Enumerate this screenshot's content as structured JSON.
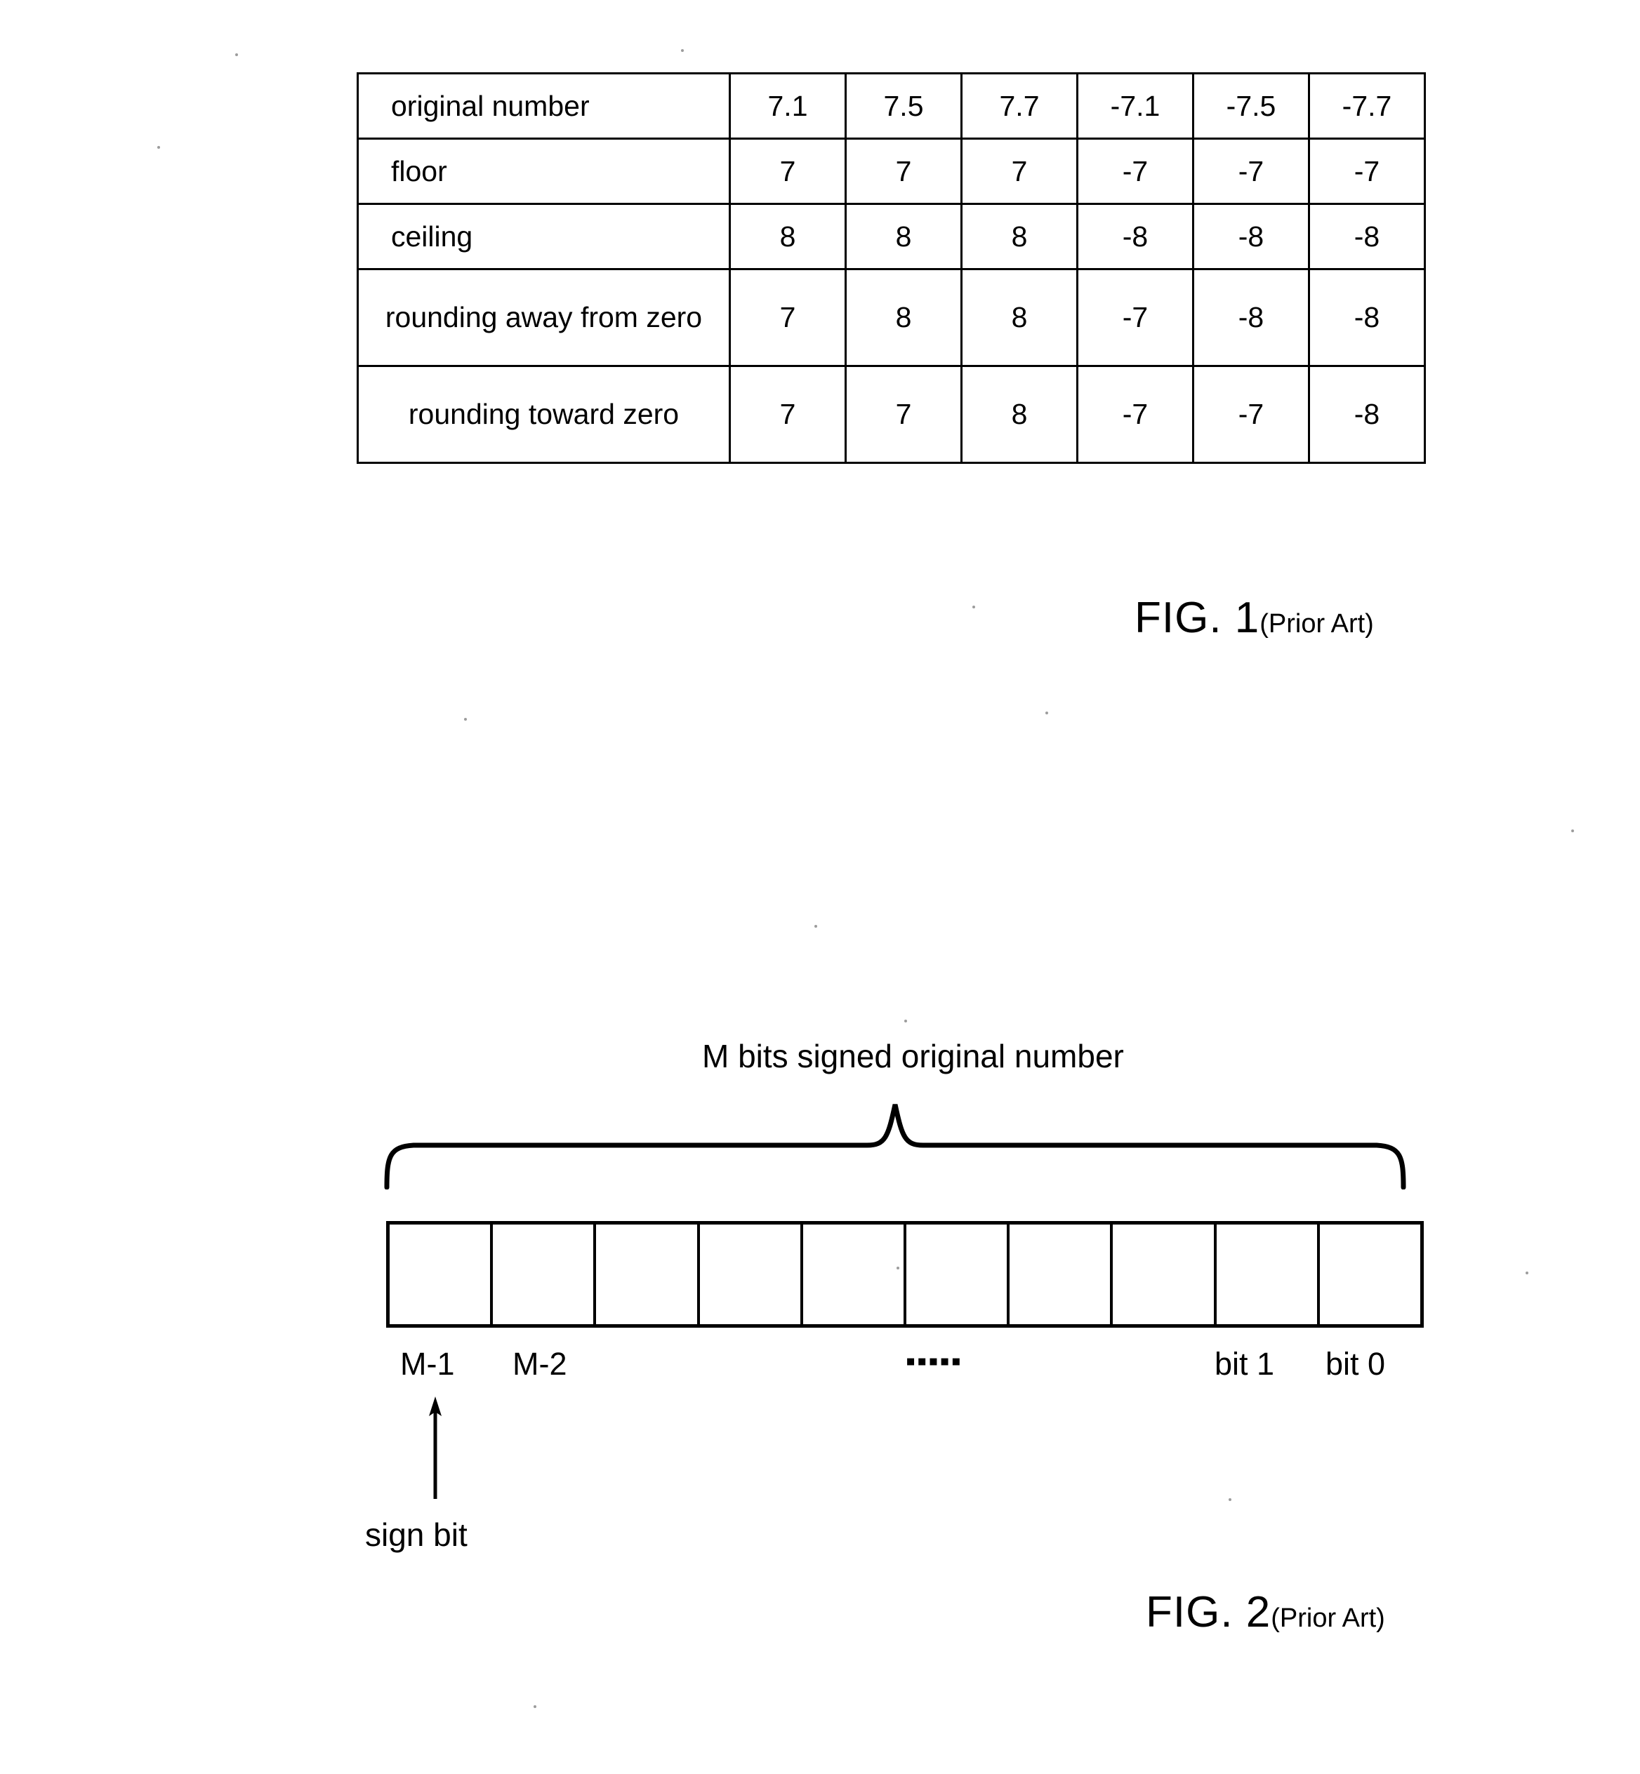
{
  "figure1": {
    "caption_main": "FIG. 1",
    "caption_sub": "(Prior Art)",
    "table": {
      "rows": [
        {
          "label": "original number",
          "wrapped": false,
          "values": [
            "7.1",
            "7.5",
            "7.7",
            "-7.1",
            "-7.5",
            "-7.7"
          ]
        },
        {
          "label": "floor",
          "wrapped": false,
          "values": [
            "7",
            "7",
            "7",
            "-7",
            "-7",
            "-7"
          ]
        },
        {
          "label": "ceiling",
          "wrapped": false,
          "values": [
            "8",
            "8",
            "8",
            "-8",
            "-8",
            "-8"
          ]
        },
        {
          "label": "rounding away from zero",
          "wrapped": true,
          "values": [
            "7",
            "8",
            "8",
            "-7",
            "-8",
            "-8"
          ]
        },
        {
          "label": "rounding toward zero",
          "wrapped": true,
          "values": [
            "7",
            "7",
            "8",
            "-7",
            "-7",
            "-8"
          ]
        }
      ]
    }
  },
  "figure2": {
    "caption_main": "FIG. 2",
    "caption_sub": "(Prior Art)",
    "title": "M bits signed original number",
    "bit_cells": [
      "",
      "",
      "",
      "",
      "",
      "",
      "",
      "",
      "",
      ""
    ],
    "bit_labels": {
      "msb": "M-1",
      "msb_minus_1": "M-2",
      "ellipsis": "▪▪▪▪▪",
      "bit_1": "bit 1",
      "bit_0": "bit 0"
    },
    "sign_bit_label": "sign bit"
  }
}
